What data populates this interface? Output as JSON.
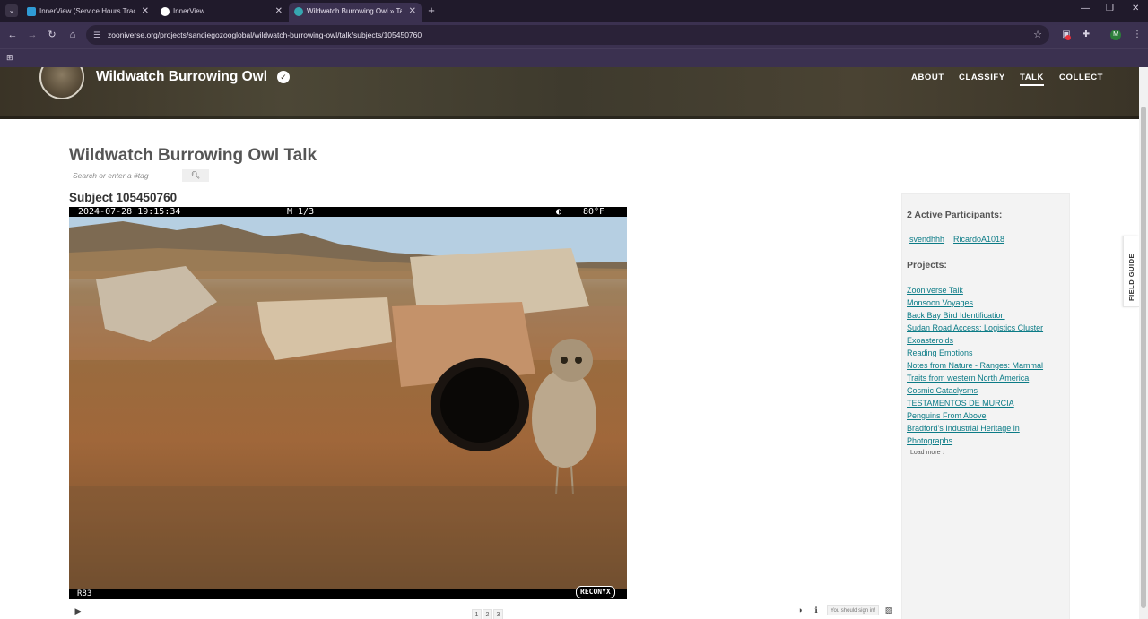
{
  "browser": {
    "tabs": [
      {
        "title": "InnerView (Service Hours Tracke",
        "active": false
      },
      {
        "title": "InnerView",
        "active": false
      },
      {
        "title": "Wildwatch Burrowing Owl » Talk",
        "active": true
      }
    ],
    "new_tab": "+",
    "url": "zooniverse.org/projects/sandiegozooglobal/wildwatch-burrowing-owl/talk/subjects/105450760",
    "profile_initial": "M"
  },
  "project": {
    "title": "Wildwatch Burrowing Owl",
    "verified_mark": "✓",
    "nav": [
      {
        "label": "ABOUT",
        "active": false
      },
      {
        "label": "CLASSIFY",
        "active": false
      },
      {
        "label": "TALK",
        "active": true
      },
      {
        "label": "COLLECT",
        "active": false
      }
    ]
  },
  "talk": {
    "title": "Wildwatch Burrowing Owl Talk",
    "search_placeholder": "Search or enter a #tag"
  },
  "subject": {
    "title": "Subject 105450760",
    "camera": {
      "datetime": "2024-07-28 19:15:34",
      "mode": "M 1/3",
      "moon": "◐",
      "temperature": "80°F",
      "code": "R83",
      "brand": "RECONYX"
    },
    "frames": [
      "1",
      "2",
      "3"
    ],
    "signin_note": "You should sign in!"
  },
  "sidebar": {
    "participants_heading": "2 Active Participants:",
    "participants": [
      "svendhhh",
      "RicardoA1018"
    ],
    "projects_heading": "Projects:",
    "projects": [
      "Zooniverse Talk",
      "Monsoon Voyages",
      "Back Bay Bird Identification",
      "Sudan Road Access: Logistics Cluster",
      "Exoasteroids",
      "Reading Emotions",
      "Notes from Nature - Ranges: Mammal ",
      "Traits from western North America",
      "Cosmic Cataclysms ",
      "TESTAMENTOS DE MURCIA",
      "Penguins From Above",
      "Bradford's Industrial Heritage in ",
      "Photographs"
    ],
    "load_more": "Load more ↓"
  },
  "field_guide": "FIELD GUIDE"
}
